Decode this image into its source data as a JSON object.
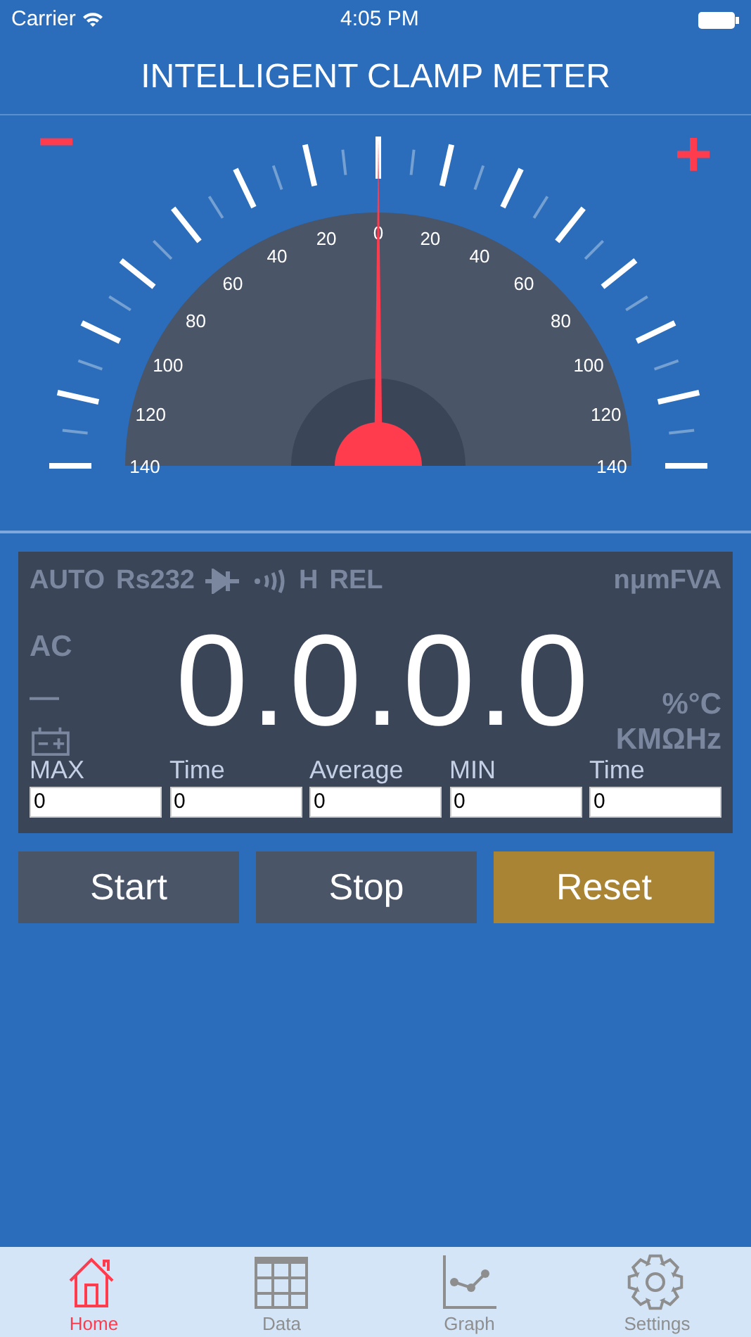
{
  "status_bar": {
    "carrier": "Carrier",
    "time": "4:05 PM"
  },
  "title": "INTELLIGENT CLAMP METER",
  "gauge": {
    "minus": "−",
    "plus": "+",
    "level": 0.5,
    "left_labels": [
      "0",
      "20",
      "40",
      "60",
      "80",
      "100",
      "120",
      "140"
    ],
    "right_labels": [
      "20",
      "40",
      "60",
      "80",
      "100",
      "120",
      "140"
    ]
  },
  "display": {
    "reading": "0.0.0.0",
    "top_indicators": [
      {
        "kind": "text",
        "text": "AUTO",
        "on": false
      },
      {
        "kind": "text",
        "text": "Rs232",
        "on": false
      },
      {
        "kind": "diode",
        "on": false
      },
      {
        "kind": "sound",
        "on": false
      },
      {
        "kind": "text",
        "text": "H",
        "on": false
      },
      {
        "kind": "text",
        "text": "REL",
        "on": false
      }
    ],
    "right_indicators": [
      {
        "kind": "text",
        "text": "nμmFVA",
        "on": false
      }
    ],
    "left_indicators": [
      {
        "kind": "text",
        "text": "AC",
        "on": false
      },
      {
        "kind": "text",
        "text": "—",
        "on": false
      },
      {
        "kind": "battery",
        "on": false
      }
    ],
    "unit_indicators": [
      {
        "kind": "text",
        "text": "%°C",
        "on": false
      },
      {
        "kind": "text",
        "text": "KMΩHz",
        "on": false
      }
    ],
    "stats": [
      {
        "label": "MAX",
        "value": "0"
      },
      {
        "label": "Time",
        "value": "0"
      },
      {
        "label": "Average",
        "value": "0"
      },
      {
        "label": "MIN",
        "value": "0"
      },
      {
        "label": "Time",
        "value": "0"
      }
    ]
  },
  "buttons": [
    {
      "label": "Start",
      "color": "#4a5568"
    },
    {
      "label": "Stop",
      "color": "#4a5568"
    },
    {
      "label": "Reset",
      "color": "#a98434"
    }
  ],
  "tabs": [
    {
      "label": "Home",
      "kind": "home",
      "selected": true
    },
    {
      "label": "Data",
      "kind": "table",
      "selected": false
    },
    {
      "label": "Graph",
      "kind": "graph",
      "selected": false
    },
    {
      "label": "Settings",
      "kind": "gear",
      "selected": false
    }
  ]
}
